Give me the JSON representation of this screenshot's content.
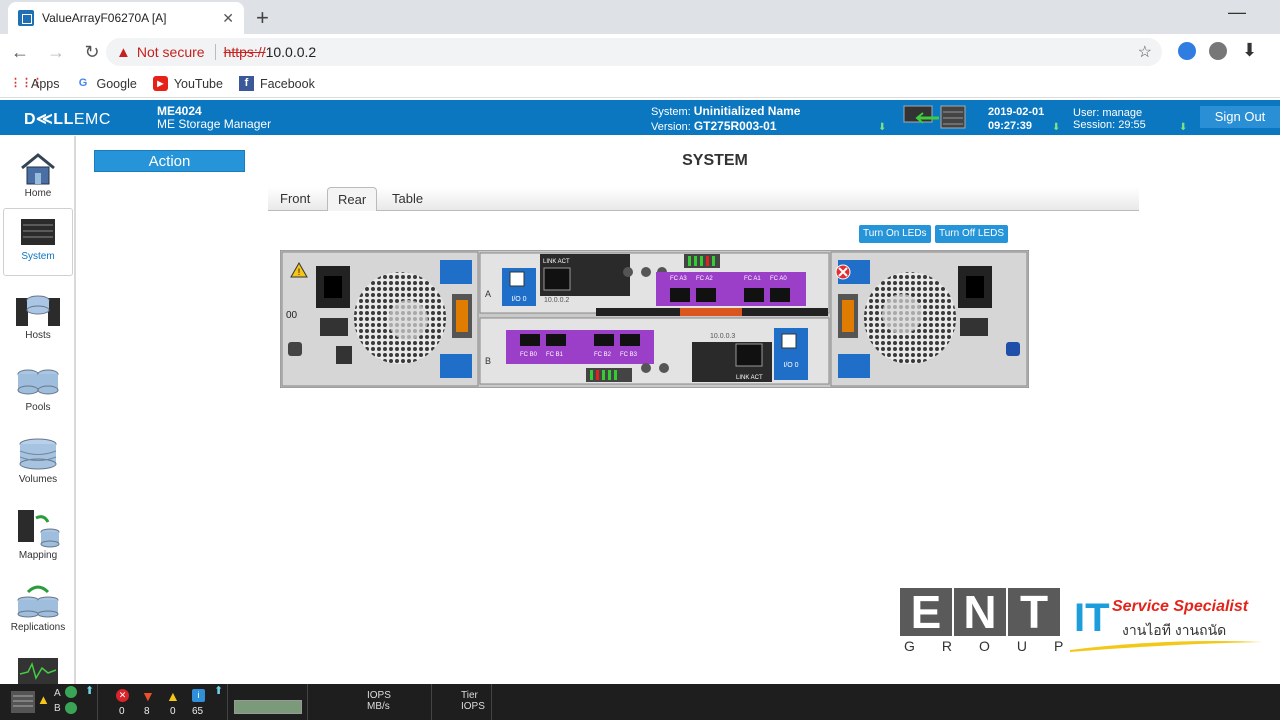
{
  "browser": {
    "tab_title": "ValueArrayF06270A [A]",
    "not_secure": "Not secure",
    "url_scheme": "https://",
    "url_host": "10.0.0.2",
    "bookmarks": [
      "Apps",
      "Google",
      "YouTube",
      "Facebook"
    ]
  },
  "header": {
    "brand_bold": "D≪LL",
    "brand_rest": "EMC",
    "model": "ME4024",
    "product": "ME Storage Manager",
    "system_label": "System:",
    "system_name": "Uninitialized Name",
    "version_label": "Version:",
    "version": "GT275R003-01",
    "date": "2019-02-01",
    "time": "09:27:39",
    "user_label": "User:",
    "user": "manage",
    "session_label": "Session:",
    "session": "29:55",
    "sign_out": "Sign Out"
  },
  "sidebar": {
    "items": [
      "Home",
      "System",
      "Hosts",
      "Pools",
      "Volumes",
      "Mapping",
      "Replications"
    ],
    "active": "System"
  },
  "main": {
    "action_label": "Action",
    "title": "SYSTEM",
    "tabs": [
      "Front",
      "Rear",
      "Table"
    ],
    "active_tab": "Rear",
    "led_on": "Turn On LEDs",
    "led_off": "Turn Off LEDS"
  },
  "enclosure": {
    "enclosure_id": "00",
    "controller_a": "A",
    "controller_b": "B",
    "ip_a": "10.0.0.2",
    "ip_b": "10.0.0.3",
    "io_port": "I/O 0",
    "link_act": "LINK  ACT",
    "ports_a": [
      "FC A3",
      "FC A2",
      "FC A1",
      "FC A0"
    ],
    "ports_b": [
      "FC B0",
      "FC B1",
      "FC B2",
      "FC B3"
    ]
  },
  "statusbar": {
    "ctrl_a": "A",
    "ctrl_b": "B",
    "critical": "0",
    "error": "8",
    "warning": "0",
    "info": "65",
    "iops": "IOPS",
    "mbs": "MB/s",
    "tier": "Tier",
    "tier_iops": "IOPS"
  },
  "watermark": {
    "letters": [
      "E",
      "N",
      "T"
    ],
    "group": "GROUP",
    "it": "IT",
    "tagline": "Service Specialist",
    "thai": "งานไอที งานถนัด"
  },
  "colors": {
    "header_blue": "#0a77c0",
    "button_blue": "#2594d8",
    "fc_purple": "#9b3fc9"
  }
}
